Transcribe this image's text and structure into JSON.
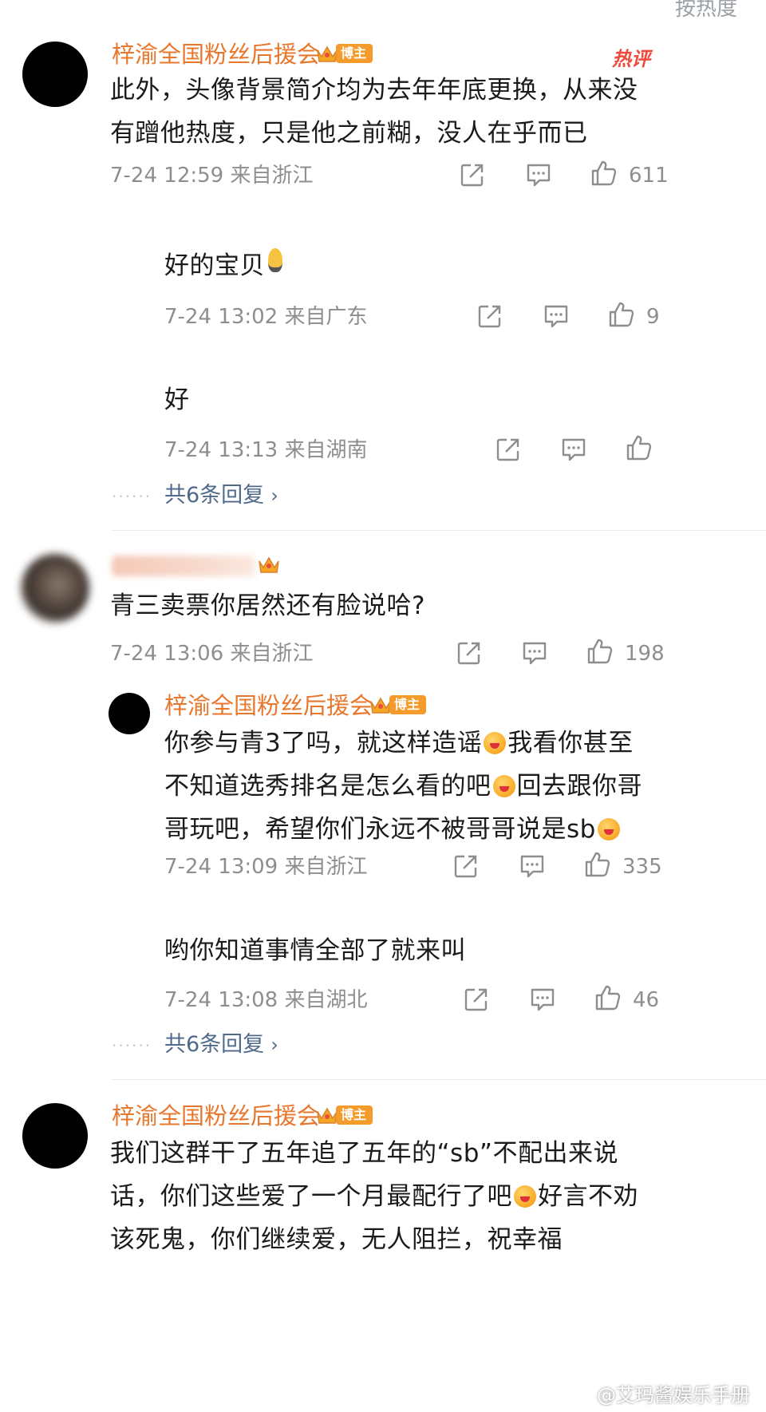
{
  "header_fragment": "按热度",
  "comments": [
    {
      "name": "梓渝全国粉丝后援会",
      "tag": "博主",
      "hot": "热评",
      "lines": [
        "此外，头像背景简介均为去年年底更换，从来没",
        "有蹭他热度，只是他之前糊，没人在乎而已"
      ],
      "meta": "7-24 12:59 来自浙江",
      "likes": "611",
      "replies": [
        {
          "text": "好的宝贝",
          "meta": "7-24 13:02 来自广东",
          "likes": "9"
        },
        {
          "text": "好",
          "meta": "7-24 13:13 来自湖南",
          "likes": ""
        }
      ],
      "more": "共6条回复"
    },
    {
      "name": "",
      "text": "青三卖票你居然还有脸说哈?",
      "meta": "7-24 13:06 来自浙江",
      "likes": "198",
      "replies": [
        {
          "name": "梓渝全国粉丝后援会",
          "tag": "博主",
          "line1a": "你参与青3了吗，就这样造谣",
          "line1b": "我看你甚至",
          "line2a": "不知道选秀排名是怎么看的吧",
          "line2b": "回去跟你哥",
          "line3a": "哥玩吧，希望你们永远不被哥哥说是sb",
          "meta": "7-24 13:09 来自浙江",
          "likes": "335"
        },
        {
          "text": "哟你知道事情全部了就来叫",
          "meta": "7-24 13:08 来自湖北",
          "likes": "46"
        }
      ],
      "more": "共6条回复"
    },
    {
      "name": "梓渝全国粉丝后援会",
      "tag": "博主",
      "line1": "我们这群干了五年追了五年的“sb”不配出来说",
      "line2a": "话，你们这些爱了一个月最配行了吧",
      "line2b": "好言不劝",
      "line3": "该死鬼，你们继续爱，无人阻拦，祝幸福"
    }
  ],
  "watermark": "@艾玛酱娱乐手册",
  "icons": {
    "share": "share-icon",
    "comment": "comment-icon",
    "like": "thumbs-up-icon",
    "crown": "crown-icon",
    "emoji": "laughing-emoji-icon",
    "bulb": "lightbulb-emoji-icon"
  },
  "colors": {
    "username": "#e8772e",
    "tag_bg": "#f59b2b",
    "hot": "#ef4a3b",
    "meta": "#8e8e8e",
    "more_link": "#506a8c"
  }
}
